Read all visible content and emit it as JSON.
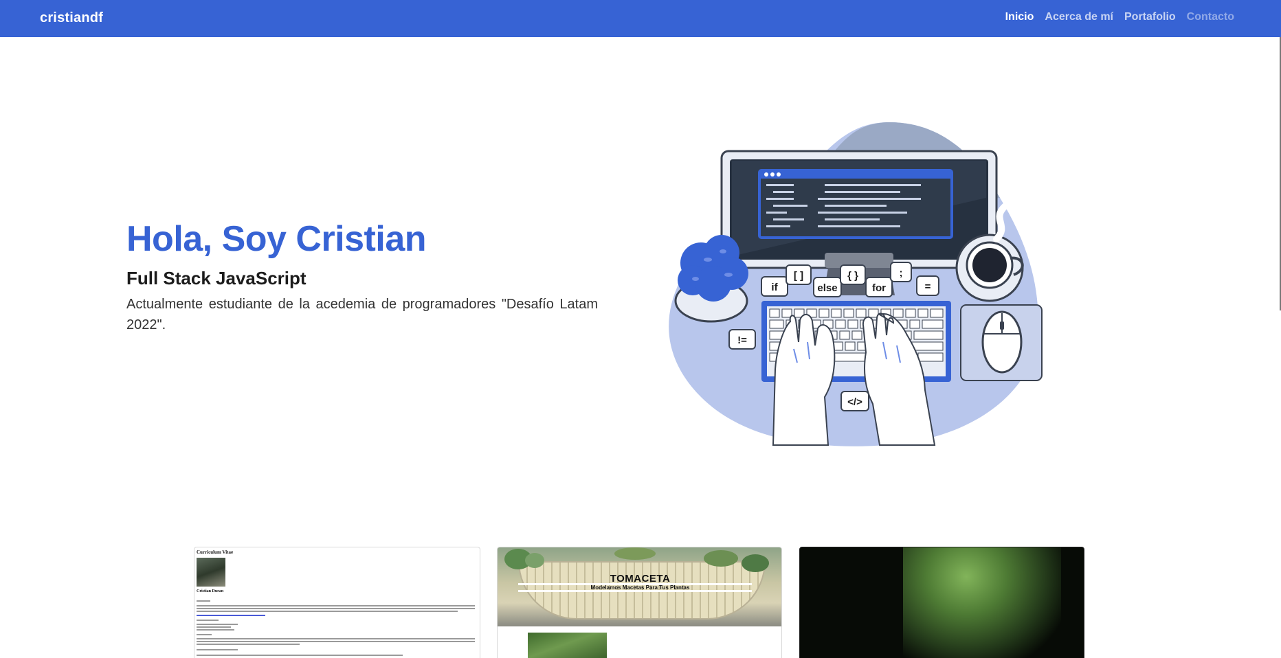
{
  "nav": {
    "brand": "cristiandf",
    "links": [
      {
        "label": "Inicio"
      },
      {
        "label": "Acerca de mí"
      },
      {
        "label": "Portafolio"
      },
      {
        "label": "Contacto"
      }
    ]
  },
  "hero": {
    "title": "Hola, Soy Cristian",
    "subtitle": "Full Stack JavaScript",
    "description": "Actualmente estudiante de la acedemia de programadores \"Desafío Latam 2022\".",
    "code_bubbles": [
      "if",
      "[ ]",
      "else",
      "{ }",
      "for",
      ";",
      "=",
      "!=",
      "</>"
    ]
  },
  "projects": {
    "cv": {
      "title": "Curriculum Vitae",
      "name": "Cristian Duran"
    },
    "tomaceta": {
      "title": "TOMACETA",
      "tagline": "Modelamos Macetas Para Tus Plantas"
    }
  },
  "colors": {
    "primary": "#3763d4",
    "illustration_bg": "#b8c6ec",
    "dark": "#263140"
  }
}
